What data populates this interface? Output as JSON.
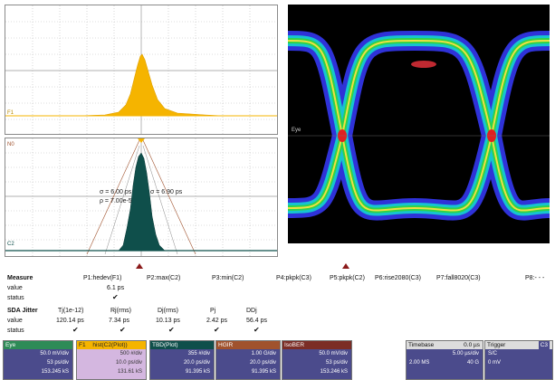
{
  "panels": {
    "top_label_left": "F1",
    "mid_label_left": "N0",
    "bottom_label_left": "C2",
    "sigma_left": "σ = 6.00 ps",
    "rho_left": "ρ = 7.00e-5",
    "sigma_right": "σ = 6.90 ps",
    "eye_label": "Eye"
  },
  "measure": {
    "title": "Measure",
    "value_label": "value",
    "status_label": "status",
    "params": [
      {
        "name": "P1:hedev(F1)",
        "value": "6.1 ps"
      },
      {
        "name": "P2:max(C2)",
        "value": ""
      },
      {
        "name": "P3:min(C2)",
        "value": ""
      },
      {
        "name": "P4:pkpk(C3)",
        "value": ""
      },
      {
        "name": "P5:pkpk(C2)",
        "value": ""
      },
      {
        "name": "P6:rise2080(C3)",
        "value": ""
      },
      {
        "name": "P7:fall8020(C3)",
        "value": ""
      },
      {
        "name": "P8:- - -",
        "value": ""
      }
    ]
  },
  "jitter": {
    "title": "SDA Jitter",
    "value_label": "value",
    "status_label": "status",
    "cols": [
      {
        "name": "Tj(1e-12)",
        "value": "120.14 ps"
      },
      {
        "name": "Rj(rms)",
        "value": "7.34 ps"
      },
      {
        "name": "Dj(rms)",
        "value": "10.13 ps"
      },
      {
        "name": "Pj",
        "value": "2.42 ps"
      },
      {
        "name": "DDj",
        "value": "56.4 ps"
      }
    ]
  },
  "tiles": [
    {
      "label": "Eye",
      "rows": [
        "50.0 mV/div",
        "53 ps/div",
        "153.245 kS"
      ]
    },
    {
      "label": "F1",
      "sublabel": "hist(C2(Plot))",
      "rows": [
        "500 #/div",
        "10.0 ps/div",
        "131.61 kS"
      ]
    },
    {
      "label": "TBD(Plot)",
      "rows": [
        "355 #/div",
        "20.0 ps/div",
        "91.395 kS"
      ]
    },
    {
      "label": "HGIR",
      "rows": [
        "1.00 G/div",
        "20.0 ps/div",
        "91.395 kS"
      ]
    },
    {
      "label": "IsoBER",
      "rows": [
        "50.0 mV/div",
        "53 ps/div",
        "153.246 kS"
      ]
    }
  ],
  "timebase": {
    "label": "Timebase",
    "value1": "0.0 µs",
    "value2": "5.00 µs/div",
    "value3": "2.00 MS",
    "value4": "40 G"
  },
  "trigger": {
    "label": "Trigger",
    "badge": "C3",
    "value1": "S/C",
    "value2": "0 mV"
  },
  "colors": {
    "hist": "#f5b400",
    "dark_hist": "#0f4f4b",
    "tile_blue": "#4b4b8c",
    "tile_purple": "#d4b7e0",
    "eye_bg": "#000000"
  }
}
